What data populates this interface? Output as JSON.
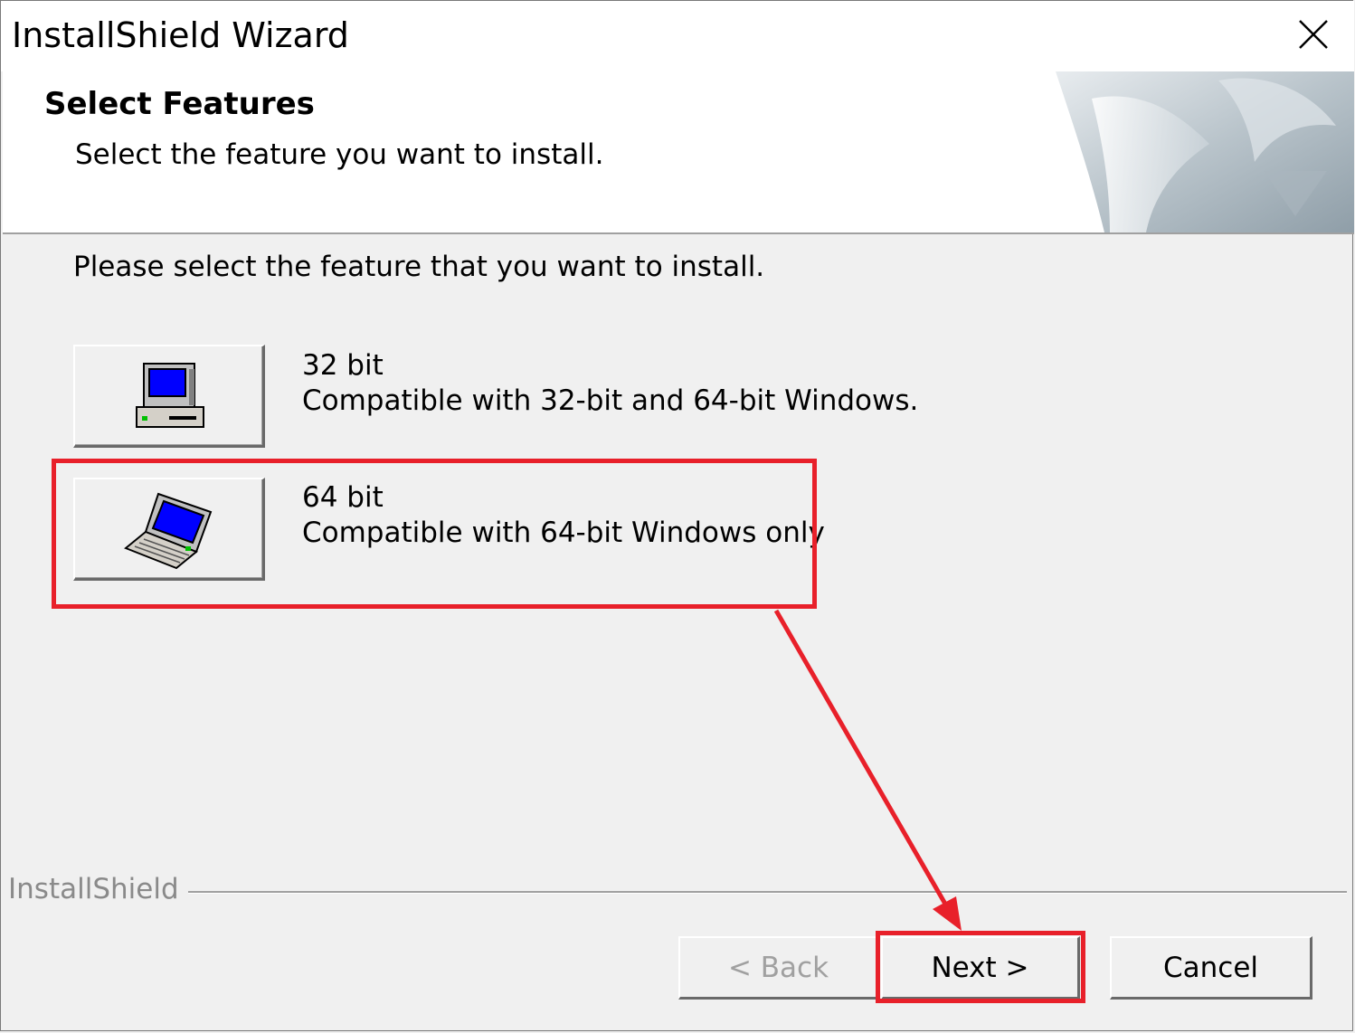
{
  "window": {
    "title": "InstallShield Wizard",
    "close_icon": "close-icon"
  },
  "header": {
    "title": "Select Features",
    "subtitle": "Select the feature you want to install."
  },
  "main": {
    "instruction": "Please select the feature that you want to install.",
    "features": [
      {
        "name": "32 bit",
        "description": "Compatible with 32-bit and 64-bit Windows.",
        "icon": "desktop-computer-icon"
      },
      {
        "name": "64 bit",
        "description": "Compatible with 64-bit Windows only",
        "icon": "laptop-computer-icon"
      }
    ]
  },
  "footer": {
    "brand": "InstallShield",
    "back_label": "< Back",
    "next_label": "Next >",
    "cancel_label": "Cancel"
  },
  "annotation": {
    "color": "#e8202a"
  }
}
